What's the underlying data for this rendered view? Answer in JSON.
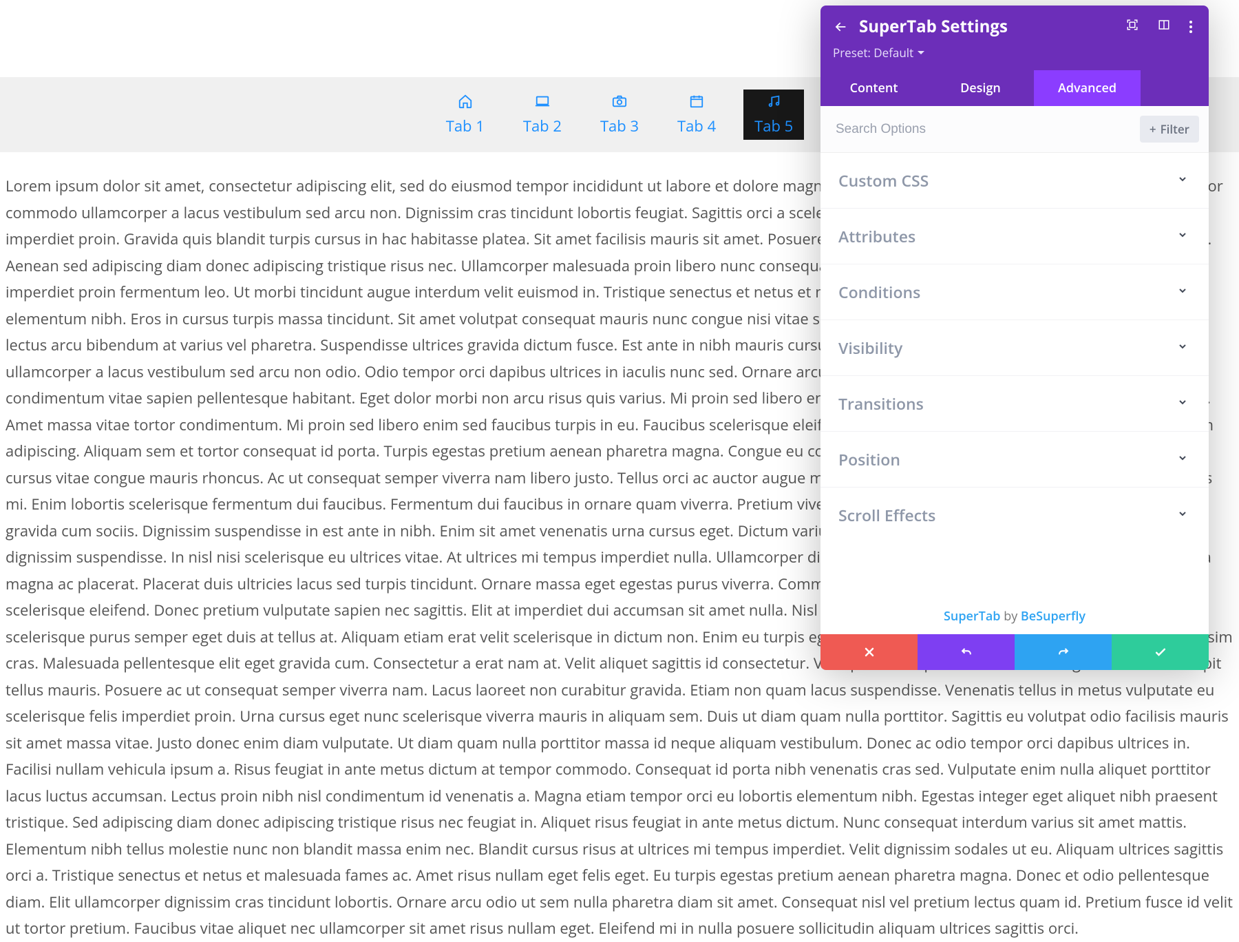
{
  "panel": {
    "title": "SuperTab Settings",
    "preset_label": "Preset: Default",
    "tabs": [
      "Content",
      "Design",
      "Advanced"
    ],
    "active_tab_index": 2,
    "search_placeholder": "Search Options",
    "filter_label": "Filter",
    "sections": [
      "Custom CSS",
      "Attributes",
      "Conditions",
      "Visibility",
      "Transitions",
      "Position",
      "Scroll Effects"
    ],
    "footer_brand": "SuperTab",
    "footer_by": "by",
    "footer_link": "BeSuperfly"
  },
  "tabs_preview": {
    "items": [
      {
        "label": "Tab 1",
        "icon": "home-icon",
        "active": false
      },
      {
        "label": "Tab 2",
        "icon": "laptop-icon",
        "active": false
      },
      {
        "label": "Tab 3",
        "icon": "camera-icon",
        "active": false
      },
      {
        "label": "Tab 4",
        "icon": "calendar-icon",
        "active": false
      },
      {
        "label": "Tab 5",
        "icon": "music-icon",
        "active": true
      }
    ],
    "content": "Lorem ipsum dolor sit amet, consectetur adipiscing elit, sed do eiusmod tempor incididunt ut labore et dolore magna aliqua. Ac tincidunt vitae semper quis lectus. At tempor commodo ullamcorper a lacus vestibulum sed arcu non. Dignissim cras tincidunt lobortis feugiat. Sagittis orci a scelerisque purus. In metus vulputate eu scelerisque felis imperdiet proin. Gravida quis blandit turpis cursus in hac habitasse platea. Sit amet facilisis mauris sit amet. Posuere lorem ipsum dolor sit amet consectetur adipiscing elit. Aenean sed adipiscing diam donec adipiscing tristique risus nec. Ullamcorper malesuada proin libero nunc consequat interdum varius. Vulputate eu scelerisque felis imperdiet proin fermentum leo. Ut morbi tincidunt augue interdum velit euismod in. Tristique senectus et netus et malesuada fames ac. Etiam tempor orci eu lobortis elementum nibh. Eros in cursus turpis massa tincidunt. Sit amet volutpat consequat mauris nunc congue nisi vitae suscipit. Magna sit amet purus gravida quis. Augue ut lectus arcu bibendum at varius vel pharetra. Suspendisse ultrices gravida dictum fusce. Est ante in nibh mauris cursus. Tempus iaculis urna id volutpat. Tempor commodo ullamcorper a lacus vestibulum sed arcu non odio. Odio tempor orci dapibus ultrices in iaculis nunc sed. Ornare arcu dui vivamus arcu felis bibendum ut tristique et. A condimentum vitae sapien pellentesque habitant. Eget dolor morbi non arcu risus quis varius. Mi proin sed libero enim sed faucibus. Vitae nunc sed velit dignissim sodales. Amet massa vitae tortor condimentum. Mi proin sed libero enim sed faucibus turpis in eu. Faucibus scelerisque eleifend donec pretium. Elementum nisi quis eleifend quam adipiscing. Aliquam sem et tortor consequat id porta. Turpis egestas pretium aenean pharetra magna. Congue eu consequat ac felis donec. Nullam vehicula ipsum a arcu cursus vitae congue mauris rhoncus. Ac ut consequat semper viverra nam libero justo. Tellus orci ac auctor augue mauris augue neque. Aliquam id diam maecenas ultricies mi. Enim lobortis scelerisque fermentum dui faucibus. Fermentum dui faucibus in ornare quam viverra. Pretium viverra suspendisse potenti nullam. Pellentesque elit eget gravida cum sociis. Dignissim suspendisse in est ante in nibh. Enim sit amet venenatis urna cursus eget. Dictum varius duis at consectetur lorem. Pretium quam vulputate dignissim suspendisse. In nisl nisi scelerisque eu ultrices vitae. At ultrices mi tempus imperdiet nulla. Ullamcorper dignissim cras tincidunt lobortis feugiat. Aenean pharetra magna ac placerat. Placerat duis ultricies lacus sed turpis tincidunt. Ornare massa eget egestas purus viverra. Commodo sed egestas egestas fringilla phasellus faucibus scelerisque eleifend. Donec pretium vulputate sapien nec sagittis. Elit at imperdiet dui accumsan sit amet nulla. Nisl nisi scelerisque eu ultrices vitae auctor eu. Orci a scelerisque purus semper eget duis at tellus at. Aliquam etiam erat velit scelerisque in dictum non. Enim eu turpis egestas pretium. Est pellentesque elit ullamcorper dignissim cras. Malesuada pellentesque elit eget gravida cum. Consectetur a erat nam at. Velit aliquet sagittis id consectetur. Volutpat consequat mauris nunc congue nisi vitae suscipit tellus mauris. Posuere ac ut consequat semper viverra nam. Lacus laoreet non curabitur gravida. Etiam non quam lacus suspendisse. Venenatis tellus in metus vulputate eu scelerisque felis imperdiet proin. Urna cursus eget nunc scelerisque viverra mauris in aliquam sem. Duis ut diam quam nulla porttitor. Sagittis eu volutpat odio facilisis mauris sit amet massa vitae. Justo donec enim diam vulputate. Ut diam quam nulla porttitor massa id neque aliquam vestibulum. Donec ac odio tempor orci dapibus ultrices in. Facilisi nullam vehicula ipsum a. Risus feugiat in ante metus dictum at tempor commodo. Consequat id porta nibh venenatis cras sed. Vulputate enim nulla aliquet porttitor lacus luctus accumsan. Lectus proin nibh nisl condimentum id venenatis a. Magna etiam tempor orci eu lobortis elementum nibh. Egestas integer eget aliquet nibh praesent tristique. Sed adipiscing diam donec adipiscing tristique risus nec feugiat in. Aliquet risus feugiat in ante metus dictum. Nunc consequat interdum varius sit amet mattis. Elementum nibh tellus molestie nunc non blandit massa enim nec. Blandit cursus risus at ultrices mi tempus imperdiet. Velit dignissim sodales ut eu. Aliquam ultrices sagittis orci a. Tristique senectus et netus et malesuada fames ac. Amet risus nullam eget felis eget. Eu turpis egestas pretium aenean pharetra magna. Donec et odio pellentesque diam. Elit ullamcorper dignissim cras tincidunt lobortis. Ornare arcu odio ut sem nulla pharetra diam sit amet. Consequat nisl vel pretium lectus quam id. Pretium fusce id velit ut tortor pretium. Faucibus vitae aliquet nec ullamcorper sit amet risus nullam eget. Eleifend mi in nulla posuere sollicitudin aliquam ultrices sagittis orci."
  }
}
